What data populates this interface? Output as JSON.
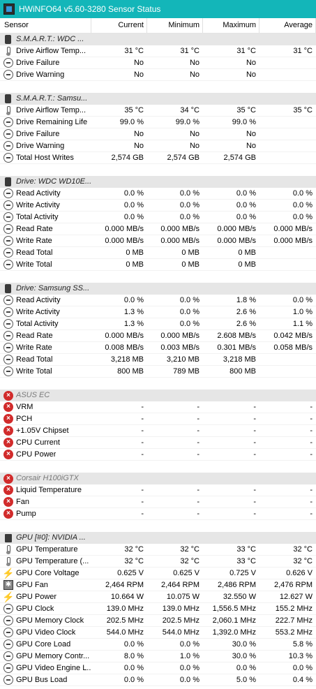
{
  "window": {
    "title": "HWiNFO64 v5.60-3280 Sensor Status"
  },
  "columns": [
    "Sensor",
    "Current",
    "Minimum",
    "Maximum",
    "Average"
  ],
  "rows": [
    {
      "type": "group",
      "icon": "disk-icon",
      "label": "S.M.A.R.T.: WDC ..."
    },
    {
      "type": "sensor",
      "icon": "thermometer-icon",
      "label": "Drive Airflow Temp...",
      "cur": "31 °C",
      "min": "31 °C",
      "max": "31 °C",
      "avg": "31 °C"
    },
    {
      "type": "sensor",
      "icon": "minus-circle-icon",
      "label": "Drive Failure",
      "cur": "No",
      "min": "No",
      "max": "No",
      "avg": ""
    },
    {
      "type": "sensor",
      "icon": "minus-circle-icon",
      "label": "Drive Warning",
      "cur": "No",
      "min": "No",
      "max": "No",
      "avg": ""
    },
    {
      "type": "blank"
    },
    {
      "type": "group",
      "icon": "disk-icon",
      "label": "S.M.A.R.T.: Samsu..."
    },
    {
      "type": "sensor",
      "icon": "thermometer-icon",
      "label": "Drive Airflow Temp...",
      "cur": "35 °C",
      "min": "34 °C",
      "max": "35 °C",
      "avg": "35 °C"
    },
    {
      "type": "sensor",
      "icon": "minus-circle-icon",
      "label": "Drive Remaining Life",
      "cur": "99.0 %",
      "min": "99.0 %",
      "max": "99.0 %",
      "avg": ""
    },
    {
      "type": "sensor",
      "icon": "minus-circle-icon",
      "label": "Drive Failure",
      "cur": "No",
      "min": "No",
      "max": "No",
      "avg": ""
    },
    {
      "type": "sensor",
      "icon": "minus-circle-icon",
      "label": "Drive Warning",
      "cur": "No",
      "min": "No",
      "max": "No",
      "avg": ""
    },
    {
      "type": "sensor",
      "icon": "minus-circle-icon",
      "label": "Total Host Writes",
      "cur": "2,574 GB",
      "min": "2,574 GB",
      "max": "2,574 GB",
      "avg": ""
    },
    {
      "type": "blank"
    },
    {
      "type": "group",
      "icon": "disk-icon",
      "label": "Drive: WDC WD10E..."
    },
    {
      "type": "sensor",
      "icon": "minus-circle-icon",
      "label": "Read Activity",
      "cur": "0.0 %",
      "min": "0.0 %",
      "max": "0.0 %",
      "avg": "0.0 %"
    },
    {
      "type": "sensor",
      "icon": "minus-circle-icon",
      "label": "Write Activity",
      "cur": "0.0 %",
      "min": "0.0 %",
      "max": "0.0 %",
      "avg": "0.0 %"
    },
    {
      "type": "sensor",
      "icon": "minus-circle-icon",
      "label": "Total Activity",
      "cur": "0.0 %",
      "min": "0.0 %",
      "max": "0.0 %",
      "avg": "0.0 %"
    },
    {
      "type": "sensor",
      "icon": "minus-circle-icon",
      "label": "Read Rate",
      "cur": "0.000 MB/s",
      "min": "0.000 MB/s",
      "max": "0.000 MB/s",
      "avg": "0.000 MB/s"
    },
    {
      "type": "sensor",
      "icon": "minus-circle-icon",
      "label": "Write Rate",
      "cur": "0.000 MB/s",
      "min": "0.000 MB/s",
      "max": "0.000 MB/s",
      "avg": "0.000 MB/s"
    },
    {
      "type": "sensor",
      "icon": "minus-circle-icon",
      "label": "Read Total",
      "cur": "0 MB",
      "min": "0 MB",
      "max": "0 MB",
      "avg": ""
    },
    {
      "type": "sensor",
      "icon": "minus-circle-icon",
      "label": "Write Total",
      "cur": "0 MB",
      "min": "0 MB",
      "max": "0 MB",
      "avg": ""
    },
    {
      "type": "blank"
    },
    {
      "type": "group",
      "icon": "disk-icon",
      "label": "Drive: Samsung SS..."
    },
    {
      "type": "sensor",
      "icon": "minus-circle-icon",
      "label": "Read Activity",
      "cur": "0.0 %",
      "min": "0.0 %",
      "max": "1.8 %",
      "avg": "0.0 %"
    },
    {
      "type": "sensor",
      "icon": "minus-circle-icon",
      "label": "Write Activity",
      "cur": "1.3 %",
      "min": "0.0 %",
      "max": "2.6 %",
      "avg": "1.0 %"
    },
    {
      "type": "sensor",
      "icon": "minus-circle-icon",
      "label": "Total Activity",
      "cur": "1.3 %",
      "min": "0.0 %",
      "max": "2.6 %",
      "avg": "1.1 %"
    },
    {
      "type": "sensor",
      "icon": "minus-circle-icon",
      "label": "Read Rate",
      "cur": "0.000 MB/s",
      "min": "0.000 MB/s",
      "max": "2.608 MB/s",
      "avg": "0.042 MB/s"
    },
    {
      "type": "sensor",
      "icon": "minus-circle-icon",
      "label": "Write Rate",
      "cur": "0.008 MB/s",
      "min": "0.003 MB/s",
      "max": "0.301 MB/s",
      "avg": "0.058 MB/s"
    },
    {
      "type": "sensor",
      "icon": "minus-circle-icon",
      "label": "Read Total",
      "cur": "3,218 MB",
      "min": "3,210 MB",
      "max": "3,218 MB",
      "avg": ""
    },
    {
      "type": "sensor",
      "icon": "minus-circle-icon",
      "label": "Write Total",
      "cur": "800 MB",
      "min": "789 MB",
      "max": "800 MB",
      "avg": ""
    },
    {
      "type": "blank"
    },
    {
      "type": "group",
      "gray": true,
      "icon": "x-circle-icon",
      "label": "ASUS EC"
    },
    {
      "type": "sensor",
      "icon": "x-circle-icon",
      "label": "VRM",
      "cur": "-",
      "min": "-",
      "max": "-",
      "avg": "-"
    },
    {
      "type": "sensor",
      "icon": "x-circle-icon",
      "label": "PCH",
      "cur": "-",
      "min": "-",
      "max": "-",
      "avg": "-"
    },
    {
      "type": "sensor",
      "icon": "x-circle-icon",
      "label": "+1.05V Chipset",
      "cur": "-",
      "min": "-",
      "max": "-",
      "avg": "-"
    },
    {
      "type": "sensor",
      "icon": "x-circle-icon",
      "label": "CPU Current",
      "cur": "-",
      "min": "-",
      "max": "-",
      "avg": "-"
    },
    {
      "type": "sensor",
      "icon": "x-circle-icon",
      "label": "CPU Power",
      "cur": "-",
      "min": "-",
      "max": "-",
      "avg": "-"
    },
    {
      "type": "blank"
    },
    {
      "type": "group",
      "gray": true,
      "icon": "x-circle-icon",
      "label": "Corsair H100iGTX"
    },
    {
      "type": "sensor",
      "icon": "x-circle-icon",
      "label": "Liquid Temperature",
      "cur": "-",
      "min": "-",
      "max": "-",
      "avg": "-"
    },
    {
      "type": "sensor",
      "icon": "x-circle-icon",
      "label": "Fan",
      "cur": "-",
      "min": "-",
      "max": "-",
      "avg": "-"
    },
    {
      "type": "sensor",
      "icon": "x-circle-icon",
      "label": "Pump",
      "cur": "-",
      "min": "-",
      "max": "-",
      "avg": "-"
    },
    {
      "type": "blank"
    },
    {
      "type": "group",
      "icon": "chip-icon",
      "label": "GPU [#0]: NVIDIA ..."
    },
    {
      "type": "sensor",
      "icon": "thermometer-icon",
      "label": "GPU Temperature",
      "cur": "32 °C",
      "min": "32 °C",
      "max": "33 °C",
      "avg": "32 °C"
    },
    {
      "type": "sensor",
      "icon": "thermometer-icon",
      "label": "GPU Temperature (...",
      "cur": "32 °C",
      "min": "32 °C",
      "max": "33 °C",
      "avg": "32 °C"
    },
    {
      "type": "sensor",
      "icon": "bolt-icon",
      "label": "GPU Core Voltage",
      "cur": "0.625 V",
      "min": "0.625 V",
      "max": "0.725 V",
      "avg": "0.626 V"
    },
    {
      "type": "sensor",
      "icon": "fan-icon",
      "label": "GPU Fan",
      "cur": "2,464 RPM",
      "min": "2,464 RPM",
      "max": "2,486 RPM",
      "avg": "2,476 RPM"
    },
    {
      "type": "sensor",
      "icon": "bolt-icon",
      "label": "GPU Power",
      "cur": "10.664 W",
      "min": "10.075 W",
      "max": "32.550 W",
      "avg": "12.627 W"
    },
    {
      "type": "sensor",
      "icon": "minus-circle-icon",
      "label": "GPU Clock",
      "cur": "139.0 MHz",
      "min": "139.0 MHz",
      "max": "1,556.5 MHz",
      "avg": "155.2 MHz"
    },
    {
      "type": "sensor",
      "icon": "minus-circle-icon",
      "label": "GPU Memory Clock",
      "cur": "202.5 MHz",
      "min": "202.5 MHz",
      "max": "2,060.1 MHz",
      "avg": "222.7 MHz"
    },
    {
      "type": "sensor",
      "icon": "minus-circle-icon",
      "label": "GPU Video Clock",
      "cur": "544.0 MHz",
      "min": "544.0 MHz",
      "max": "1,392.0 MHz",
      "avg": "553.2 MHz"
    },
    {
      "type": "sensor",
      "icon": "minus-circle-icon",
      "label": "GPU Core Load",
      "cur": "0.0 %",
      "min": "0.0 %",
      "max": "30.0 %",
      "avg": "5.8 %"
    },
    {
      "type": "sensor",
      "icon": "minus-circle-icon",
      "label": "GPU Memory Contr...",
      "cur": "8.0 %",
      "min": "1.0 %",
      "max": "30.0 %",
      "avg": "10.3 %"
    },
    {
      "type": "sensor",
      "icon": "minus-circle-icon",
      "label": "GPU Video Engine L...",
      "cur": "0.0 %",
      "min": "0.0 %",
      "max": "0.0 %",
      "avg": "0.0 %"
    },
    {
      "type": "sensor",
      "icon": "minus-circle-icon",
      "label": "GPU Bus Load",
      "cur": "0.0 %",
      "min": "0.0 %",
      "max": "5.0 %",
      "avg": "0.4 %"
    }
  ]
}
